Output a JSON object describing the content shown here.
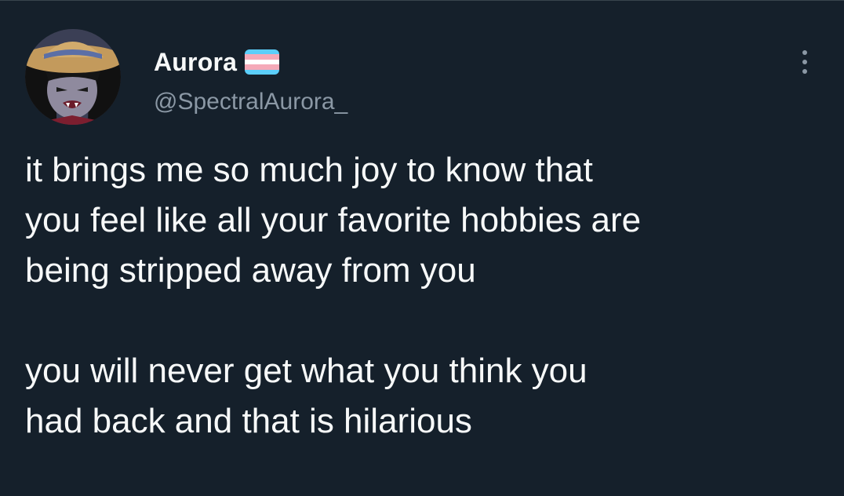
{
  "author": {
    "display_name": "Aurora",
    "handle": "@SpectralAurora_",
    "flag": {
      "icon": "transgender-flag-icon",
      "stripes": [
        "#5bcefa",
        "#f5a9b8",
        "#ffffff",
        "#f5a9b8",
        "#5bcefa"
      ]
    },
    "avatar": "cartoon-character-avatar"
  },
  "menu": {
    "icon": "more-options-icon"
  },
  "tweet": {
    "paragraph_1": [
      "it brings me so much joy to know that",
      "you feel like all your favorite hobbies are",
      "being stripped away from you"
    ],
    "paragraph_2": [
      "you will never get what you think you",
      "had back and that is hilarious"
    ]
  },
  "colors": {
    "background": "#15202b",
    "primary_text": "#f7f9f9",
    "secondary_text": "#8b98a5"
  }
}
